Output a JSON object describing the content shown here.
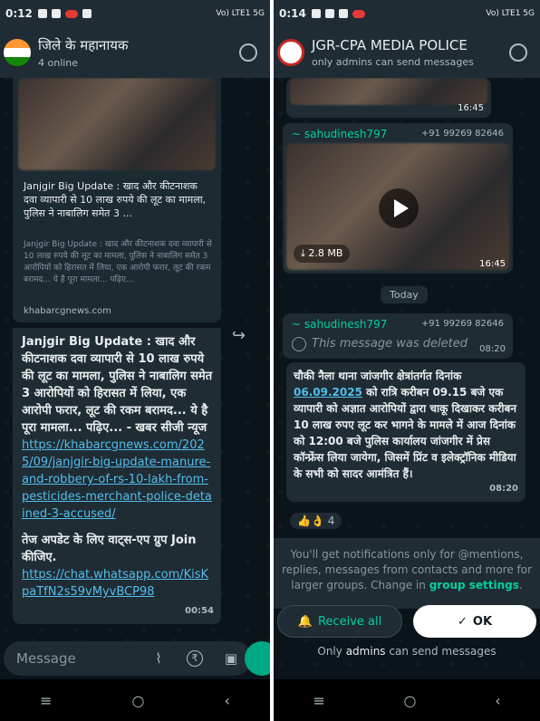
{
  "left": {
    "status": {
      "time": "0:12",
      "network": "Vo) LTE1 5G"
    },
    "header": {
      "title": "जिले के महानायक",
      "subtitle": "4 online"
    },
    "link_preview": {
      "title": "Janjgir Big Update : खाद और कीटनाशक दवा व्यापारी से 10 लाख रुपये की लूट का मामला, पुलिस ने नाबालिग समेत 3 ...",
      "description": "Janjgir Big Update : खाद और कीटनाशक दवा व्यापारी से 10 लाख रुपये की लूट का मामला, पुलिस ने नाबालिग समेत 3 आरोपियों को हिरासत में लिया, एक आरोपी फरार, लूट की रकम बरामद... ये है पूरा मामला... पढ़िए...",
      "domain": "khabarcgnews.com"
    },
    "message": {
      "text": "Janjgir Big Update : खाद और कीटनाशक दवा व्यापारी से 10 लाख रुपये की लूट का मामला, पुलिस ने नाबालिग समेत 3 आरोपियों को हिरासत में लिया, एक आरोपी फरार, लूट की रकम बरामद... ये है पूरा मामला... पढ़िए... - खबर सीजी न्यूज",
      "link1": "https://khabarcgnews.com/2025/09/janjgir-big-update-manure-and-robbery-of-rs-10-lakh-from-pesticides-merchant-police-detained-3-accused/",
      "text2": "तेज अपडेट के लिए वाट्स-एप ग्रुप Join कीजिए.",
      "link2": "https://chat.whatsapp.com/KisKpaTfN2s59vMyvBCP98",
      "time": "00:54"
    },
    "input": {
      "placeholder": "Message"
    }
  },
  "right": {
    "status": {
      "time": "0:14",
      "network": "Vo) LTE1 5G"
    },
    "header": {
      "title": "JGR-CPA MEDIA POLICE",
      "subtitle": "only admins can send messages"
    },
    "top_bubble_time": "16:45",
    "video_msg": {
      "sender": "~ sahudinesh797",
      "phone": "+91 99269 82646",
      "size": "2.8 MB",
      "time": "16:45"
    },
    "day": "Today",
    "deleted_msg": {
      "sender": "~ sahudinesh797",
      "phone": "+91 99269 82646",
      "text": "This message was deleted",
      "time": "08:20"
    },
    "text_msg": {
      "part1": "चौकी नैला थाना जांजगीर क्षेत्रांतर्गत दिनांक ",
      "date": "06.09.2025",
      "part2": " को रात्रि करीबन 09.15 बजे एक व्यापारी को अज्ञात आरोपियों द्वारा चाकू दिखाकर करीबन 10 लाख रुपए लूट कर भागने के मामले में आज दिनांक को 12:00 बजे पुलिस कार्यालय जांजगीर में प्रेस कॉन्फ्रेंस लिया जायेगा, जिसमें प्रिंट व इलेक्ट्रॉनिक मीडिया के सभी को सादर आमंत्रित हैं।",
      "time": "08:20",
      "reactions": "👍👌",
      "reaction_count": "4"
    },
    "notify": {
      "text": "You'll get notifications only for @mentions, replies, messages from contacts and more for larger groups. Change in",
      "link": "group settings",
      "end": "."
    },
    "buttons": {
      "receive_all": "Receive all",
      "ok": "OK"
    },
    "footer": {
      "prefix": "Only",
      "admins": "admins",
      "suffix": "can send messages"
    }
  }
}
